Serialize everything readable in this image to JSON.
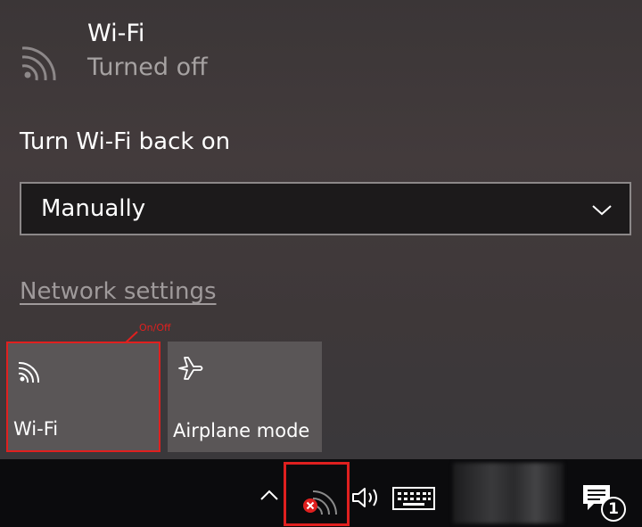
{
  "wifi_panel": {
    "title": "Wi-Fi",
    "status": "Turned off",
    "turn_on_label": "Turn Wi-Fi back on",
    "turn_on_selected": "Manually",
    "network_settings_link": "Network settings"
  },
  "annotation": {
    "label": "On/Off",
    "color": "#e0201f"
  },
  "quick_actions": [
    {
      "label": "Wi-Fi",
      "icon": "wifi-icon"
    },
    {
      "label": "Airplane mode",
      "icon": "airplane-icon"
    }
  ],
  "taskbar": {
    "icons": [
      "chevron-up-icon",
      "wifi-disconnected-icon",
      "volume-icon",
      "keyboard-icon",
      "notification-icon"
    ],
    "notification_count": "1"
  }
}
